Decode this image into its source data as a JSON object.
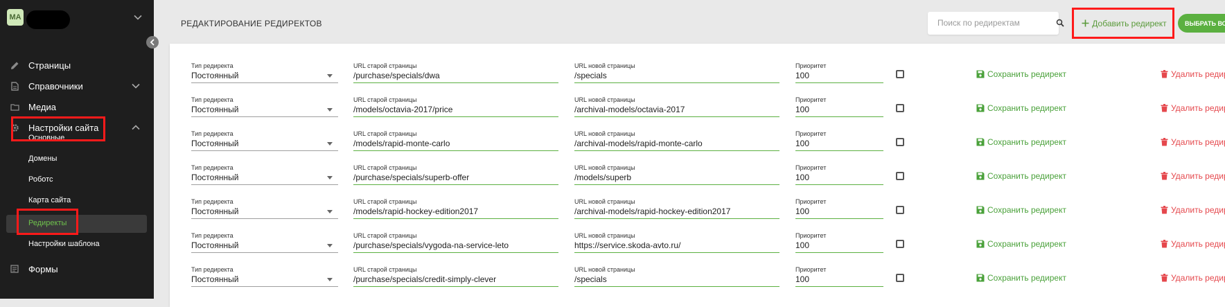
{
  "user": {
    "initials": "MA"
  },
  "nav": [
    {
      "label": "Страницы",
      "icon": "pencil-icon"
    },
    {
      "label": "Справочники",
      "icon": "document-icon"
    },
    {
      "label": "Медиа",
      "icon": "folder-icon"
    },
    {
      "label": "Настройки сайта",
      "icon": "gear-icon"
    },
    {
      "label": "Формы",
      "icon": "form-icon"
    }
  ],
  "submenu": [
    "Основные",
    "Домены",
    "Роботс",
    "Карта сайта",
    "Редиректы",
    "Настройки шаблона"
  ],
  "header": {
    "title": "РЕДАКТИРОВАНИЕ РЕДИРЕКТОВ",
    "search_placeholder": "Поиск по редиректам",
    "add_label": "Добавить редирект",
    "select_all_label": "ВЫБРАТЬ ВСЕ"
  },
  "labels": {
    "type": "Тип редиректа",
    "old_url": "URL старой страницы",
    "new_url": "URL новой страницы",
    "priority": "Приоритет",
    "save": "Сохранить редирект",
    "delete": "Удалить редирект"
  },
  "rows": [
    {
      "type": "Постоянный",
      "old": "/purchase/specials/dwa",
      "new": "/specials",
      "priority": "100"
    },
    {
      "type": "Постоянный",
      "old": "/models/octavia-2017/price",
      "new": "/archival-models/octavia-2017",
      "priority": "100"
    },
    {
      "type": "Постоянный",
      "old": "/models/rapid-monte-carlo",
      "new": "/archival-models/rapid-monte-carlo",
      "priority": "100"
    },
    {
      "type": "Постоянный",
      "old": "/purchase/specials/superb-offer",
      "new": "/models/superb",
      "priority": "100"
    },
    {
      "type": "Постоянный",
      "old": "/models/rapid-hockey-edition2017",
      "new": "/archival-models/rapid-hockey-edition2017",
      "priority": "100"
    },
    {
      "type": "Постоянный",
      "old": "/purchase/specials/vygoda-na-service-leto",
      "new": "https://service.skoda-avto.ru/",
      "priority": "100"
    },
    {
      "type": "Постоянный",
      "old": "/purchase/specials/credit-simply-clever",
      "new": "/specials",
      "priority": "100"
    }
  ],
  "colors": {
    "accent": "#5bb040",
    "danger": "#e5484d",
    "sidebar": "#1e1e1e",
    "highlight": "#ff1a1a"
  }
}
